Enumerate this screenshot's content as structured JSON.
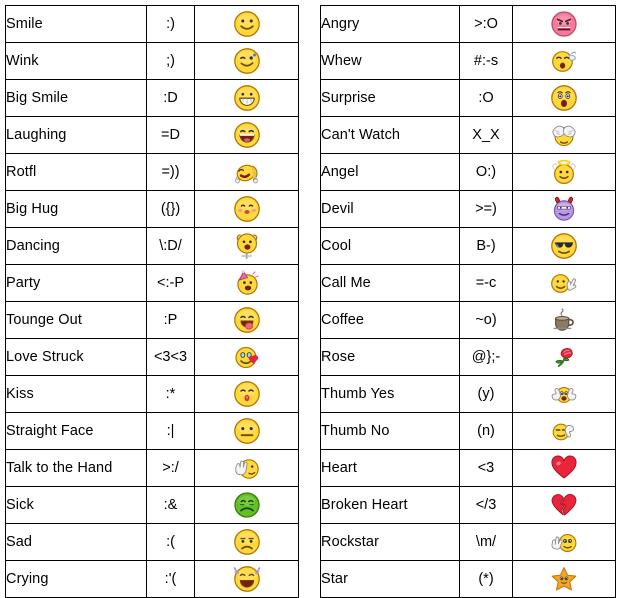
{
  "page": {
    "title": "Emoticon Shortcut Reference",
    "background_color": "#ffffff",
    "border_color": "#000000",
    "text_color": "#000000"
  },
  "tables": [
    {
      "id": "left",
      "rows": [
        {
          "name": "Smile",
          "code": ":)",
          "icon": "smile-face-icon"
        },
        {
          "name": "Wink",
          "code": ";)",
          "icon": "wink-face-icon"
        },
        {
          "name": "Big Smile",
          "code": ":D",
          "icon": "big-smile-face-icon"
        },
        {
          "name": "Laughing",
          "code": "=D",
          "icon": "laughing-face-icon"
        },
        {
          "name": "Rotfl",
          "code": "=))",
          "icon": "rolling-on-floor-icon"
        },
        {
          "name": "Big Hug",
          "code": "({})",
          "icon": "big-hug-face-icon"
        },
        {
          "name": "Dancing",
          "code": "\\:D/",
          "icon": "dancing-face-icon"
        },
        {
          "name": "Party",
          "code": "<:-P",
          "icon": "party-hat-face-icon"
        },
        {
          "name": "Tounge Out",
          "code": ":P",
          "icon": "tongue-out-face-icon"
        },
        {
          "name": "Love Struck",
          "code": "<3<3",
          "icon": "love-struck-face-icon"
        },
        {
          "name": "Kiss",
          "code": ":*",
          "icon": "kiss-face-icon"
        },
        {
          "name": "Straight Face",
          "code": ":|",
          "icon": "straight-face-icon"
        },
        {
          "name": "Talk to the Hand",
          "code": ">:/",
          "icon": "talk-to-the-hand-icon"
        },
        {
          "name": "Sick",
          "code": ":&",
          "icon": "sick-green-face-icon"
        },
        {
          "name": "Sad",
          "code": ":(",
          "icon": "sad-face-icon"
        },
        {
          "name": "Crying",
          "code": ":'(",
          "icon": "crying-face-icon"
        }
      ]
    },
    {
      "id": "right",
      "rows": [
        {
          "name": "Angry",
          "code": ">:O",
          "icon": "angry-red-face-icon"
        },
        {
          "name": "Whew",
          "code": "#:-s",
          "icon": "whew-sweat-face-icon"
        },
        {
          "name": "Surprise",
          "code": ":O",
          "icon": "surprised-face-icon"
        },
        {
          "name": "Can't Watch",
          "code": "X_X",
          "icon": "cant-watch-hands-icon"
        },
        {
          "name": "Angel",
          "code": "O:)",
          "icon": "angel-halo-face-icon"
        },
        {
          "name": "Devil",
          "code": ">=)",
          "icon": "devil-horns-face-icon"
        },
        {
          "name": "Cool",
          "code": "B-)",
          "icon": "cool-sunglasses-face-icon"
        },
        {
          "name": "Call Me",
          "code": "=-c",
          "icon": "call-me-hand-icon"
        },
        {
          "name": "Coffee",
          "code": "~o)",
          "icon": "coffee-cup-icon"
        },
        {
          "name": "Rose",
          "code": "@};-",
          "icon": "rose-flower-icon"
        },
        {
          "name": "Thumb Yes",
          "code": "(y)",
          "icon": "thumbs-up-icon"
        },
        {
          "name": "Thumb No",
          "code": "(n)",
          "icon": "thumbs-down-icon"
        },
        {
          "name": "Heart",
          "code": "<3",
          "icon": "heart-icon"
        },
        {
          "name": "Broken Heart",
          "code": "</3",
          "icon": "broken-heart-icon"
        },
        {
          "name": "Rockstar",
          "code": "\\m/",
          "icon": "rockstar-face-icon"
        },
        {
          "name": "Star",
          "code": "(*)",
          "icon": "star-icon"
        }
      ]
    }
  ],
  "colors": {
    "smiley_yellow": "#ffd83b",
    "smiley_yellow_dark": "#e8a317",
    "smiley_outline": "#b37700",
    "red": "#e8253a",
    "green": "#62c021",
    "purple": "#b89ae0",
    "pink": "#f27a9a",
    "hand_white": "#f4f4f4",
    "coffee_brown": "#8a7a63",
    "star_orange": "#f5a623"
  }
}
